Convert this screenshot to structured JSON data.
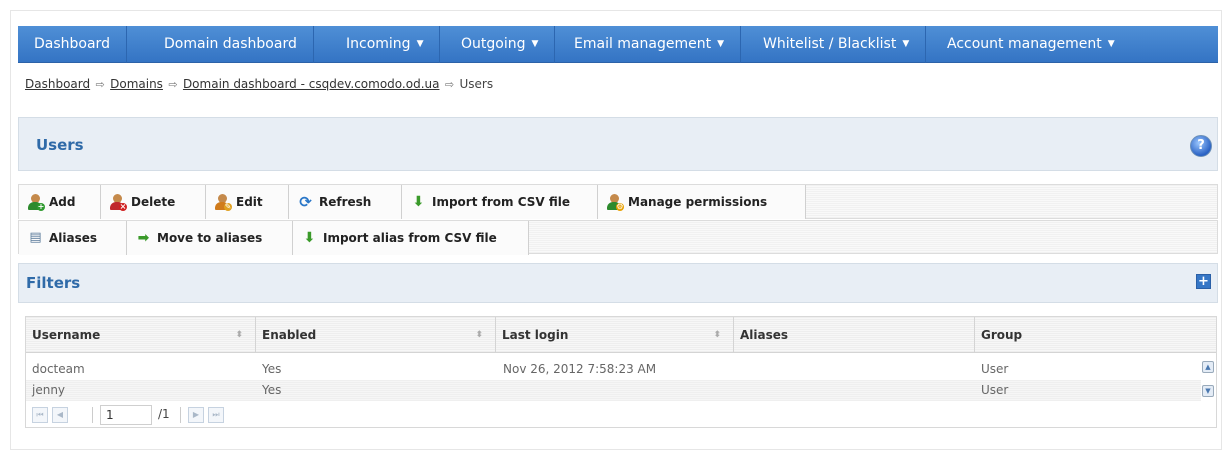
{
  "nav": {
    "items": [
      {
        "label": "Dashboard",
        "caret": ""
      },
      {
        "label": "Domain dashboard",
        "caret": ""
      },
      {
        "label": "Incoming",
        "caret": "▼"
      },
      {
        "label": "Outgoing",
        "caret": "▼"
      },
      {
        "label": "Email management",
        "caret": "▼"
      },
      {
        "label": "Whitelist / Blacklist",
        "caret": "▼"
      },
      {
        "label": "Account management",
        "caret": "▼"
      }
    ]
  },
  "breadcrumb": {
    "items": [
      "Dashboard",
      "Domains",
      "Domain dashboard - csqdev.comodo.od.ua"
    ],
    "current": "Users",
    "arrow": "⇨"
  },
  "users_panel": {
    "title": "Users",
    "help_glyph": "?"
  },
  "toolbar1": {
    "add": "Add",
    "delete": "Delete",
    "edit": "Edit",
    "refresh": "Refresh",
    "import_csv": "Import from CSV file",
    "manage_permissions": "Manage permissions"
  },
  "toolbar2": {
    "aliases": "Aliases",
    "move_to_aliases": "Move to aliases",
    "import_alias_csv": "Import alias from CSV file"
  },
  "filters": {
    "title": "Filters",
    "expand_glyph": "+"
  },
  "table": {
    "columns": [
      "Username",
      "Enabled",
      "Last login",
      "Aliases",
      "Group"
    ],
    "rows": [
      {
        "username": "docteam",
        "enabled": "Yes",
        "last_login": "Nov 26, 2012 7:58:23 AM",
        "aliases": "",
        "group": "User"
      },
      {
        "username": "jenny",
        "enabled": "Yes",
        "last_login": "",
        "aliases": "",
        "group": "User"
      }
    ]
  },
  "pager": {
    "page": "1",
    "total": "/1"
  },
  "colors": {
    "nav_bg": "#3f82cf",
    "panel_title": "#2f6aa8",
    "panel_bg": "#e8eef5"
  },
  "icons": {
    "add": "user-add-icon",
    "delete": "user-delete-icon",
    "edit": "user-edit-icon",
    "refresh": "refresh-icon",
    "import": "import-icon",
    "permissions": "permissions-icon",
    "aliases": "aliases-icon",
    "move": "move-icon",
    "help": "help-icon"
  }
}
